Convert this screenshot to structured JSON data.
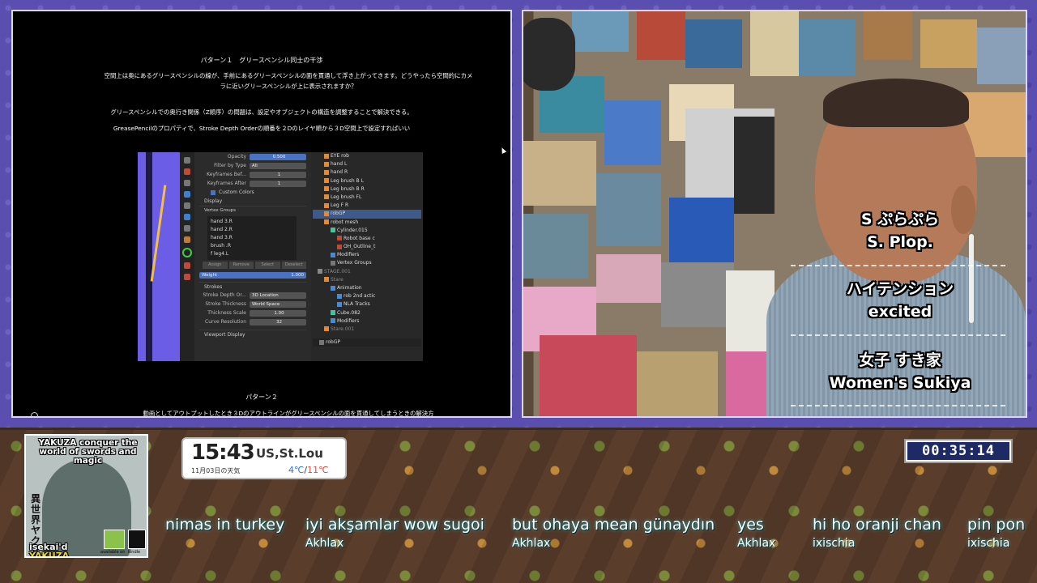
{
  "slide": {
    "title": "パターン１　グリースペンシル同士の干渉",
    "para1": "空間上は奥にあるグリースペンシルの線が、手前にあるグリースペンシルの面を貫通して浮き上がってきます。どうやったら空間的にカメラに近いグリースペンシルが上に表示されますか？",
    "para2": "グリースペンシルでの奥行き関係（Z順序）の問題は、設定やオブジェクトの構造を調整することで解決できる。",
    "para3": "GreasePencilのプロパティで、Stroke Depth Orderの順番を２Dのレイヤ順から３D空間上で設定すればいい",
    "subtitle2": "パターン２",
    "para4": "動画としてアウトプットしたとき３Dのアウトラインがグリースペンシルの面を貫通してしまうときの解決方",
    "blender": {
      "opacity_label": "Opacity",
      "opacity_value": "0.500",
      "filter_label": "Filter by Type",
      "filter_value": "All",
      "kf_before_label": "Keyframes Bef...",
      "kf_before_value": "1",
      "kf_after_label": "Keyframes After",
      "kf_after_value": "1",
      "custom_colors": "Custom Colors",
      "display": "Display",
      "vertex_groups": "Vertex Groups",
      "vg_items": [
        "hand 3.R",
        "hand 2.R",
        "hand 3.R",
        "brush .R",
        "f leg4.L"
      ],
      "assign": "Assign",
      "remove": "Remove",
      "select": "Select",
      "deselect": "Deselect",
      "weight_label": "Weight",
      "weight_value": "1.000",
      "strokes": "Strokes",
      "depth_label": "Stroke Depth Or...",
      "depth_value": "3D Location",
      "thickness_label": "Stroke Thickness",
      "thickness_value": "World Space",
      "tscale_label": "Thickness Scale",
      "tscale_value": "1.00",
      "curve_label": "Curve Resolution",
      "curve_value": "32",
      "viewport": "Viewport Display",
      "outliner": [
        "EYE rob",
        "hand L",
        "hand R",
        "Leg brush B L",
        "Leg brush B R",
        "Leg brush FL",
        "Leg F R",
        "robGP",
        "robot mesh",
        "Cylinder.015",
        "Robot base c",
        "OH_Outline_t",
        "Modifiers",
        "Vertex Groups",
        "STAGE.001",
        "Stare",
        "Animation",
        "rob 2nd actic",
        "NLA Tracks",
        "Cube.082",
        "Modifiers",
        "Stare.001"
      ],
      "selected_object": "robGP"
    }
  },
  "camera": {
    "captions": [
      {
        "jp": "S ぷらぷら",
        "en": "S. Plop."
      },
      {
        "jp": "ハイテンション",
        "en": "excited"
      },
      {
        "jp": "女子 すき家",
        "en": "Women's Sukiya"
      }
    ]
  },
  "book": {
    "title": "YAKUZA conquer the world of swords and magic",
    "kanji": "異世界ヤクザ",
    "sub_line1": "isekai'd",
    "sub_line2": "YAKUZA",
    "avail": "available on",
    "kindle": "kindle"
  },
  "weather": {
    "time": "15:43",
    "location": "US,St.Lou",
    "date": "11月03日の天気",
    "temp_low": "4℃",
    "temp_sep": "/",
    "temp_high": "11℃"
  },
  "timer": "00:35:14",
  "chat": [
    {
      "msg": "nimas in turkey",
      "user": ""
    },
    {
      "msg": "iyi akşamlar wow sugoi",
      "user": "Akhlax"
    },
    {
      "msg": "but ohaya mean günaydın",
      "user": "Akhlax"
    },
    {
      "msg": "yes",
      "user": "Akhlax"
    },
    {
      "msg": "hi ho oranji chan",
      "user": "ixischia"
    },
    {
      "msg": "pin pon",
      "user": "ixischia"
    }
  ],
  "colors": {
    "frame_purple": "#5a4fb0",
    "panel_border": "#d9d6ee",
    "timer_bg": "#1d2a66",
    "chat_glow": "#3ad6d6",
    "blender_highlight": "#4a72c4"
  }
}
